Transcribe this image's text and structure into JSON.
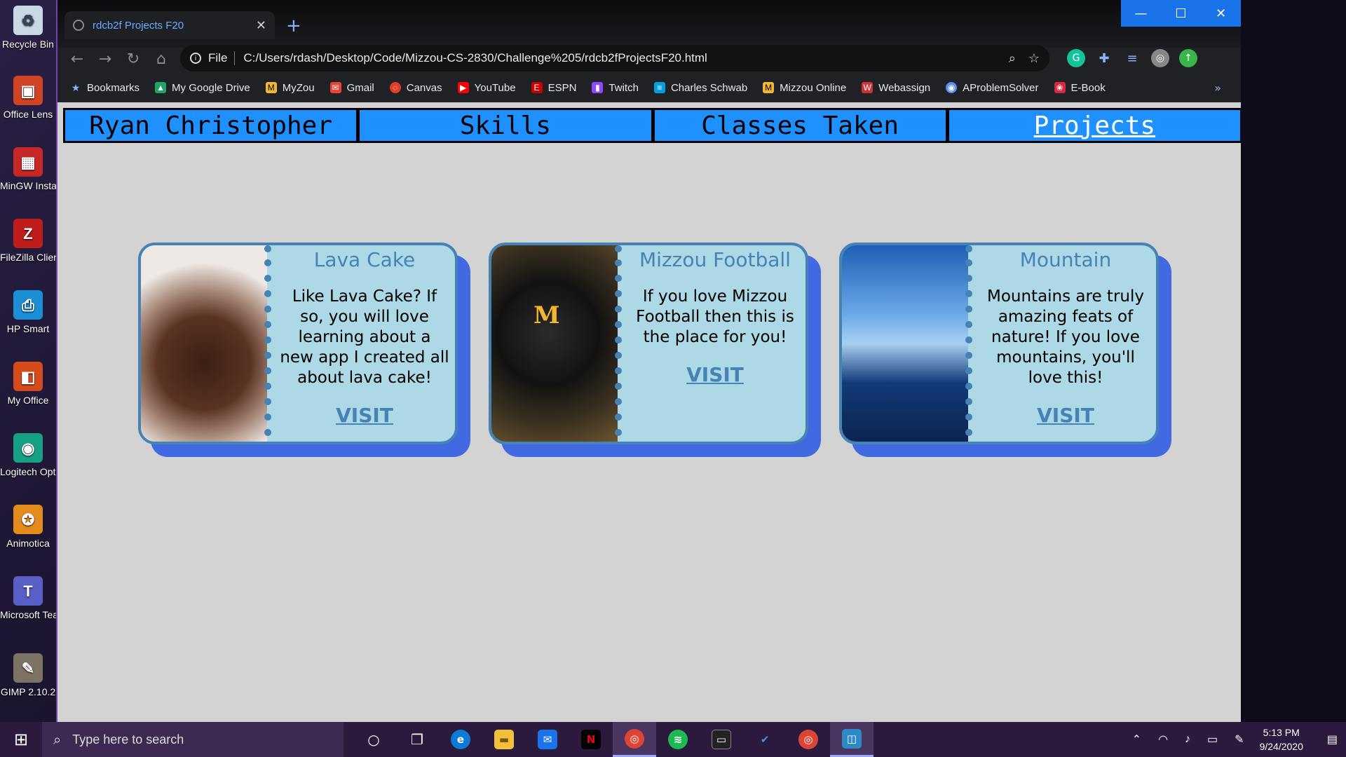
{
  "desktop": {
    "icons": [
      {
        "label": "Recycle Bin",
        "icon": "recycle-bin-icon",
        "color": "#c9d7e6"
      },
      {
        "label": "Office Lens",
        "icon": "office-lens-icon",
        "color": "#d04423"
      },
      {
        "label": "MinGW Installer",
        "icon": "mingw-icon",
        "color": "#c62828"
      },
      {
        "label": "FileZilla Client",
        "icon": "filezilla-icon",
        "color": "#bf1c1c"
      },
      {
        "label": "HP Smart",
        "icon": "hp-smart-icon",
        "color": "#1a8fd6"
      },
      {
        "label": "My Office",
        "icon": "my-office-icon",
        "color": "#d64b1c"
      },
      {
        "label": "Logitech Options",
        "icon": "logitech-icon",
        "color": "#18a085"
      },
      {
        "label": "Animotica",
        "icon": "animotica-icon",
        "color": "#e38c1c"
      },
      {
        "label": "Microsoft Teams",
        "icon": "teams-icon",
        "color": "#5a5fc7"
      },
      {
        "label": "GIMP 2.10.2",
        "icon": "gimp-icon",
        "color": "#7d7365"
      }
    ]
  },
  "browser": {
    "tab_title": "rdcb2f Projects F20",
    "url_scheme": "File",
    "url": "C:/Users/rdash/Desktop/Code/Mizzou-CS-2830/Challenge%205/rdcb2fProjectsF20.html",
    "bookmarks": [
      {
        "label": "Bookmarks",
        "icon": "star-icon",
        "color": "#8ab4f8"
      },
      {
        "label": "My Google Drive",
        "icon": "google-drive-icon",
        "color": "#1fa463"
      },
      {
        "label": "MyZou",
        "icon": "myzou-icon",
        "color": "#f1b82d"
      },
      {
        "label": "Gmail",
        "icon": "gmail-icon",
        "color": "#ea4335"
      },
      {
        "label": "Canvas",
        "icon": "canvas-icon",
        "color": "#e13c25"
      },
      {
        "label": "YouTube",
        "icon": "youtube-icon",
        "color": "#ff0000"
      },
      {
        "label": "ESPN",
        "icon": "espn-icon",
        "color": "#cc0000"
      },
      {
        "label": "Twitch",
        "icon": "twitch-icon",
        "color": "#9146ff"
      },
      {
        "label": "Charles Schwab",
        "icon": "schwab-icon",
        "color": "#00a0df"
      },
      {
        "label": "Mizzou Online",
        "icon": "mizzou-online-icon",
        "color": "#f1b82d"
      },
      {
        "label": "Webassign",
        "icon": "webassign-icon",
        "color": "#cc3333"
      },
      {
        "label": "AProblemSolver",
        "icon": "aproblemsolver-icon",
        "color": "#5b8def"
      },
      {
        "label": "E-Book",
        "icon": "ebook-icon",
        "color": "#d7263d"
      }
    ],
    "bookmarks_more": "»"
  },
  "site": {
    "nav": [
      {
        "label": "Ryan Christopher",
        "active": false
      },
      {
        "label": "Skills",
        "active": false
      },
      {
        "label": "Classes Taken",
        "active": false
      },
      {
        "label": "Projects",
        "active": true
      }
    ],
    "cards": [
      {
        "title": "Lava Cake",
        "text": "Like Lava Cake? If so, you will love learning about a new app I created all about lava cake!",
        "link": "VISIT",
        "image": "lava-cake-photo"
      },
      {
        "title": "Mizzou Football",
        "text": "If you love Mizzou Football then this is the place for you!",
        "link": "VISIT",
        "image": "mizzou-football-photo"
      },
      {
        "title": "Mountain",
        "text": "Mountains are truly amazing feats of nature! If you love mountains, you'll love this!",
        "link": "VISIT",
        "image": "mountain-photo"
      }
    ]
  },
  "taskbar": {
    "search_placeholder": "Type here to search",
    "time": "5:13 PM",
    "date": "9/24/2020"
  }
}
